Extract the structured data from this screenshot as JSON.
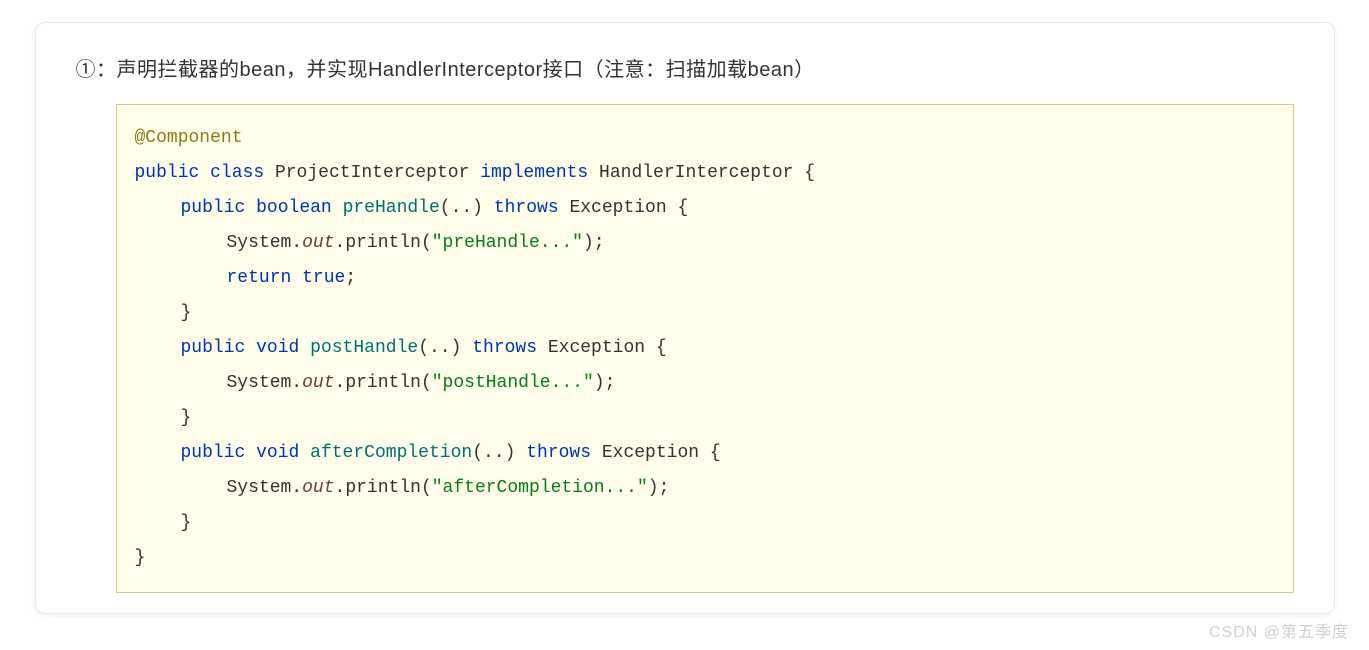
{
  "heading": "①：声明拦截器的bean，并实现HandlerInterceptor接口（注意：扫描加载bean）",
  "code": {
    "annotation": "@Component",
    "kw_public": "public",
    "kw_class": "class",
    "class_name": "ProjectInterceptor",
    "kw_implements": "implements",
    "interface_name": "HandlerInterceptor",
    "brace_open": " {",
    "m1": {
      "kw_public": "public",
      "ret": "boolean",
      "name": "preHandle",
      "args": "(..)",
      "kw_throws": "throws",
      "exc": "Exception",
      "brace_open": " {",
      "stmt_prefix": "System.",
      "stmt_out": "out",
      "stmt_mid": ".println(",
      "str": "\"preHandle...\"",
      "stmt_end": ");",
      "kw_return": "return",
      "kw_true": "true",
      "semi": ";",
      "brace_close": "}"
    },
    "m2": {
      "kw_public": "public",
      "ret": "void",
      "name": "postHandle",
      "args": "(..)",
      "kw_throws": "throws",
      "exc": "Exception",
      "brace_open": " {",
      "stmt_prefix": "System.",
      "stmt_out": "out",
      "stmt_mid": ".println(",
      "str": "\"postHandle...\"",
      "stmt_end": ");",
      "brace_close": "}"
    },
    "m3": {
      "kw_public": "public",
      "ret": "void",
      "name": "afterCompletion",
      "args": "(..)",
      "kw_throws": "throws",
      "exc": "Exception",
      "brace_open": " {",
      "stmt_prefix": "System.",
      "stmt_out": "out",
      "stmt_mid": ".println(",
      "str": "\"afterCompletion...\"",
      "stmt_end": ");",
      "brace_close": "}"
    },
    "brace_close": "}"
  },
  "watermark": "CSDN @第五季度"
}
